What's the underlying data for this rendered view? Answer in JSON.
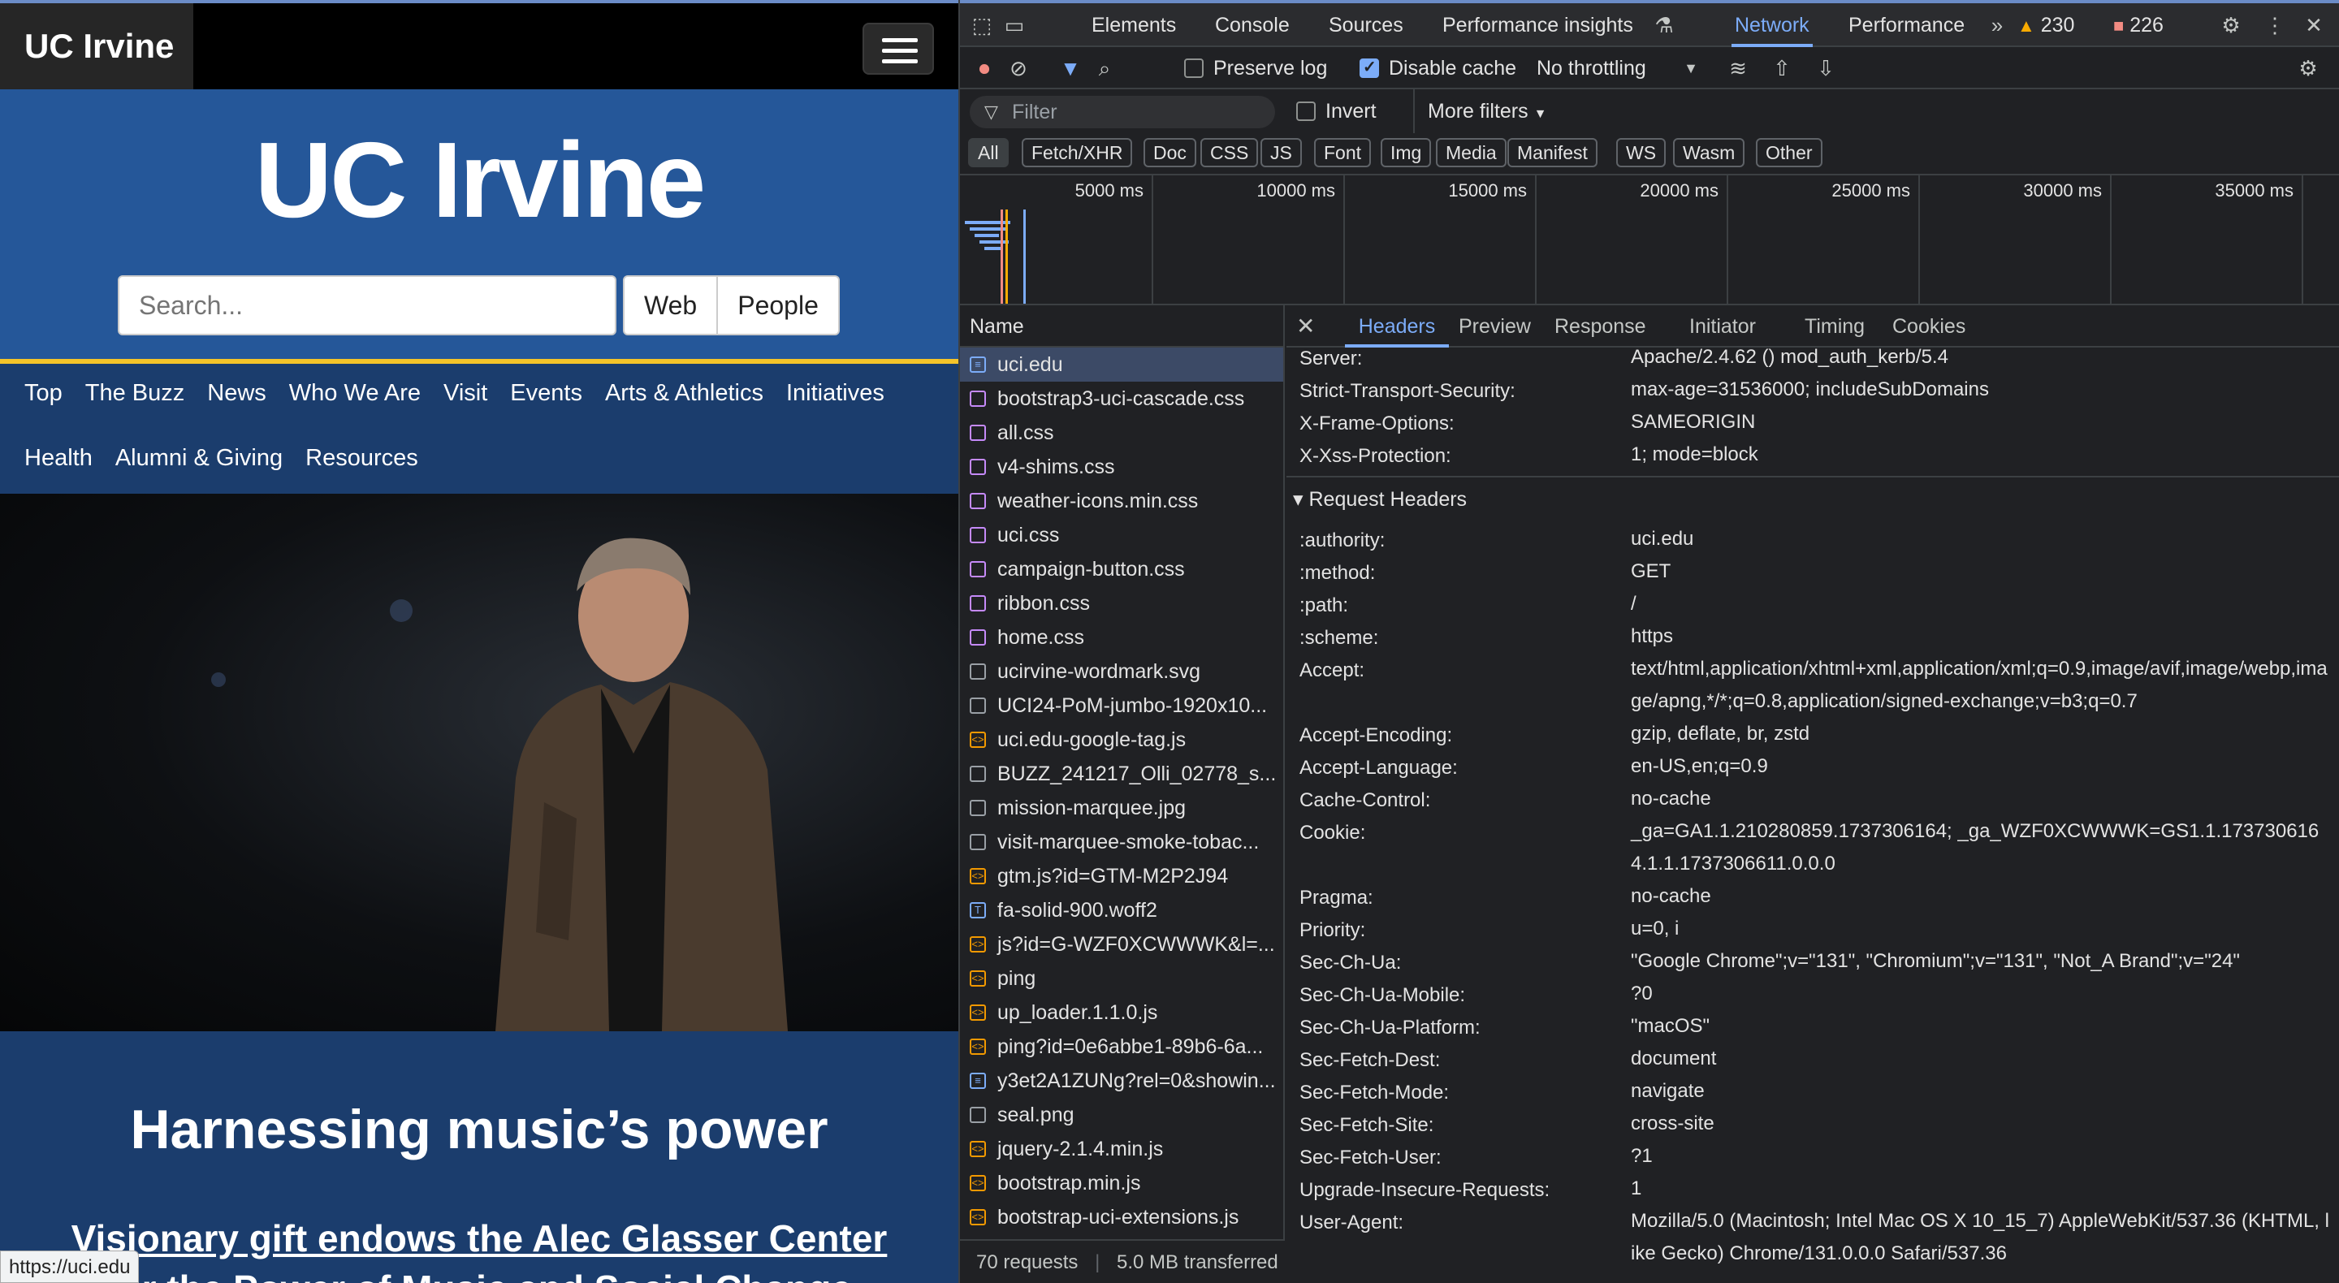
{
  "site": {
    "brand": "UC Irvine",
    "wordmark": "UC Irvine",
    "search_placeholder": "Search...",
    "btn_web": "Web",
    "btn_people": "People",
    "nav_row1": [
      "Top",
      "The Buzz",
      "News",
      "Who We Are",
      "Visit",
      "Events",
      "Arts & Athletics",
      "Initiatives"
    ],
    "nav_row2": [
      "Health",
      "Alumni & Giving",
      "Resources"
    ],
    "headline": "Harnessing music’s power",
    "subhead": "Visionary gift endows the Alec Glasser Center",
    "subhead2": "for the Power of Music and Social Change",
    "status_url": "https://uci.edu"
  },
  "devtools": {
    "tabs": [
      "Elements",
      "Console",
      "Sources",
      "Performance insights",
      "Network",
      "Performance"
    ],
    "warnings": "230",
    "errors": "226",
    "toolbar": {
      "preserve_log": "Preserve log",
      "disable_cache": "Disable cache",
      "throttling": "No throttling"
    },
    "filter_placeholder": "Filter",
    "invert": "Invert",
    "more_filters": "More filters",
    "types": [
      "All",
      "Fetch/XHR",
      "Doc",
      "CSS",
      "JS",
      "Font",
      "Img",
      "Media",
      "Manifest",
      "WS",
      "Wasm",
      "Other"
    ],
    "overview_ticks": [
      "5000 ms",
      "10000 ms",
      "15000 ms",
      "20000 ms",
      "25000 ms",
      "30000 ms",
      "35000 ms"
    ],
    "list_header": "Name",
    "requests": [
      {
        "name": "uci.edu",
        "kind": "doc"
      },
      {
        "name": "bootstrap3-uci-cascade.css",
        "kind": "css"
      },
      {
        "name": "all.css",
        "kind": "css"
      },
      {
        "name": "v4-shims.css",
        "kind": "css"
      },
      {
        "name": "weather-icons.min.css",
        "kind": "css"
      },
      {
        "name": "uci.css",
        "kind": "css"
      },
      {
        "name": "campaign-button.css",
        "kind": "css"
      },
      {
        "name": "ribbon.css",
        "kind": "css"
      },
      {
        "name": "home.css",
        "kind": "css"
      },
      {
        "name": "ucirvine-wordmark.svg",
        "kind": "img"
      },
      {
        "name": "UCI24-PoM-jumbo-1920x10...",
        "kind": "img"
      },
      {
        "name": "uci.edu-google-tag.js",
        "kind": "js"
      },
      {
        "name": "BUZZ_241217_Olli_02778_s...",
        "kind": "img"
      },
      {
        "name": "mission-marquee.jpg",
        "kind": "img"
      },
      {
        "name": "visit-marquee-smoke-tobac...",
        "kind": "img"
      },
      {
        "name": "gtm.js?id=GTM-M2P2J94",
        "kind": "js"
      },
      {
        "name": "fa-solid-900.woff2",
        "kind": "font"
      },
      {
        "name": "js?id=G-WZF0XCWWWK&l=...",
        "kind": "js"
      },
      {
        "name": "ping",
        "kind": "js"
      },
      {
        "name": "up_loader.1.1.0.js",
        "kind": "js"
      },
      {
        "name": "ping?id=0e6abbe1-89b6-6a...",
        "kind": "js"
      },
      {
        "name": "y3et2A1ZUNg?rel=0&showin...",
        "kind": "doc"
      },
      {
        "name": "seal.png",
        "kind": "img"
      },
      {
        "name": "jquery-2.1.4.min.js",
        "kind": "js"
      },
      {
        "name": "bootstrap.min.js",
        "kind": "js"
      },
      {
        "name": "bootstrap-uci-extensions.js",
        "kind": "js"
      }
    ],
    "footer": "70 requests",
    "footer_transfer": "5.0 MB transferred",
    "detail_tabs": [
      "Headers",
      "Preview",
      "Response",
      "Initiator",
      "Timing",
      "Cookies"
    ],
    "response_headers": [
      {
        "k": "Server:",
        "v": "Apache/2.4.62 () mod_auth_kerb/5.4"
      },
      {
        "k": "Strict-Transport-Security:",
        "v": "max-age=31536000; includeSubDomains"
      },
      {
        "k": "X-Frame-Options:",
        "v": "SAMEORIGIN"
      },
      {
        "k": "X-Xss-Protection:",
        "v": "1; mode=block"
      }
    ],
    "request_section": "Request Headers",
    "request_headers": [
      {
        "k": ":authority:",
        "v": "uci.edu"
      },
      {
        "k": ":method:",
        "v": "GET"
      },
      {
        "k": ":path:",
        "v": "/"
      },
      {
        "k": ":scheme:",
        "v": "https"
      },
      {
        "k": "Accept:",
        "v": "text/html,application/xhtml+xml,application/xml;q=0.9,image/avif,image/webp,image/apng,*/*;q=0.8,application/signed-exchange;v=b3;q=0.7"
      },
      {
        "k": "Accept-Encoding:",
        "v": "gzip, deflate, br, zstd"
      },
      {
        "k": "Accept-Language:",
        "v": "en-US,en;q=0.9"
      },
      {
        "k": "Cache-Control:",
        "v": "no-cache"
      },
      {
        "k": "Cookie:",
        "v": "_ga=GA1.1.210280859.1737306164; _ga_WZF0XCWWWK=GS1.1.1737306164.1.1.1737306611.0.0.0"
      },
      {
        "k": "Pragma:",
        "v": "no-cache"
      },
      {
        "k": "Priority:",
        "v": "u=0, i"
      },
      {
        "k": "Sec-Ch-Ua:",
        "v": "\"Google Chrome\";v=\"131\", \"Chromium\";v=\"131\", \"Not_A Brand\";v=\"24\""
      },
      {
        "k": "Sec-Ch-Ua-Mobile:",
        "v": "?0"
      },
      {
        "k": "Sec-Ch-Ua-Platform:",
        "v": "\"macOS\""
      },
      {
        "k": "Sec-Fetch-Dest:",
        "v": "document"
      },
      {
        "k": "Sec-Fetch-Mode:",
        "v": "navigate"
      },
      {
        "k": "Sec-Fetch-Site:",
        "v": "cross-site"
      },
      {
        "k": "Sec-Fetch-User:",
        "v": "?1"
      },
      {
        "k": "Upgrade-Insecure-Requests:",
        "v": "1"
      },
      {
        "k": "User-Agent:",
        "v": "Mozilla/5.0 (Macintosh; Intel Mac OS X 10_15_7) AppleWebKit/537.36 (KHTML, like Gecko) Chrome/131.0.0.0 Safari/537.36"
      }
    ],
    "colors": {
      "accent": "#7cacf8",
      "bg": "#202124",
      "selected_row": "#3c4a66",
      "warning": "#f9ab00",
      "error": "#f28b82"
    }
  }
}
